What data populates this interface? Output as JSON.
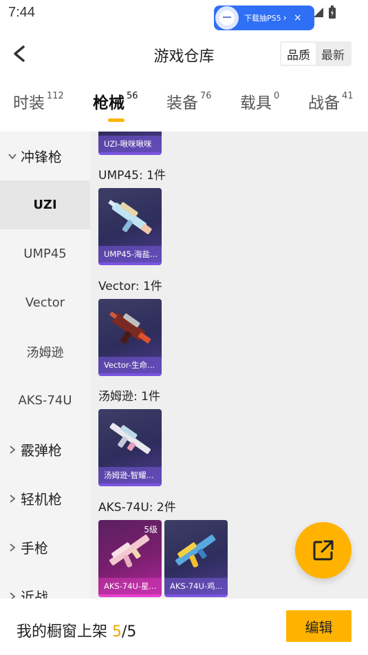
{
  "status": {
    "time": "7:44"
  },
  "ad": {
    "text": "下载抽PS5",
    "arrow": "›",
    "close": "×"
  },
  "header": {
    "title": "游戏仓库",
    "sort_options": [
      "品质",
      "最新"
    ],
    "active_sort": "品质"
  },
  "tabs": [
    {
      "label": "时装",
      "count": "112"
    },
    {
      "label": "枪械",
      "count": "56"
    },
    {
      "label": "装备",
      "count": "76"
    },
    {
      "label": "载具",
      "count": "0"
    },
    {
      "label": "战备",
      "count": "41"
    }
  ],
  "active_tab": "枪械",
  "sidebar": {
    "groups": [
      {
        "label": "冲锋枪",
        "expanded": true
      },
      {
        "label": "霰弹枪",
        "expanded": false
      },
      {
        "label": "轻机枪",
        "expanded": false
      },
      {
        "label": "手枪",
        "expanded": false
      },
      {
        "label": "近战",
        "expanded": false
      }
    ],
    "subitems": [
      "UZI",
      "UMP45",
      "Vector",
      "汤姆逊",
      "AKS-74U"
    ],
    "selected": "UZI"
  },
  "content": {
    "partial_top_card": "UZI-啾咪啾咪",
    "sections": [
      {
        "title": "UMP45: 1件",
        "items": [
          {
            "name": "UMP45-海盐...",
            "badge": ""
          }
        ]
      },
      {
        "title": "Vector: 1件",
        "items": [
          {
            "name": "Vector-生命...",
            "badge": ""
          }
        ]
      },
      {
        "title": "汤姆逊: 1件",
        "items": [
          {
            "name": "汤姆逊-智耀...",
            "badge": ""
          }
        ]
      },
      {
        "title": "AKS-74U: 2件",
        "items": [
          {
            "name": "AKS-74U-星...",
            "badge": "5级"
          },
          {
            "name": "AKS-74U-鸡...",
            "badge": ""
          }
        ]
      }
    ]
  },
  "bottom": {
    "prefix": "我的橱窗上架 ",
    "current": "5",
    "total": "/5",
    "edit_label": "编辑"
  },
  "colors": {
    "accent": "#ffb300",
    "card_purple": "#7a54e0",
    "card_pink": "#e83fd0"
  }
}
